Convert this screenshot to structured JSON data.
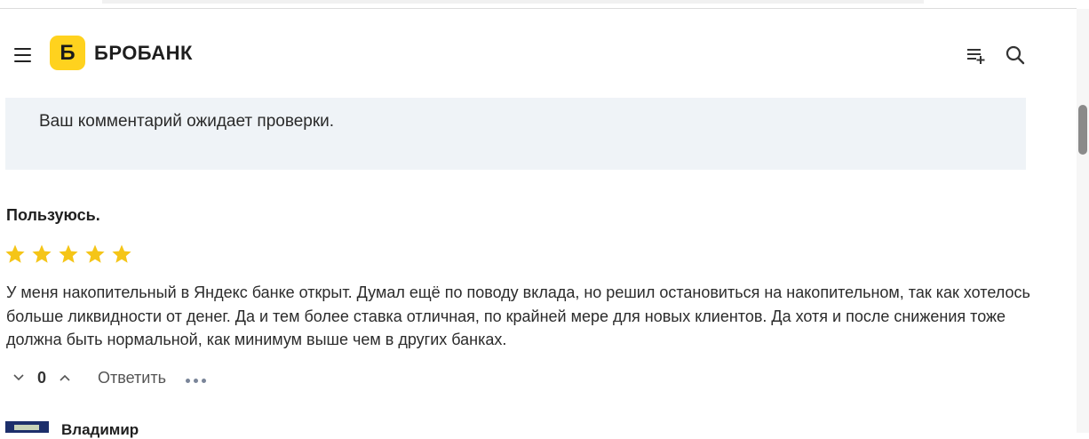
{
  "header": {
    "logo_letter": "Б",
    "logo_name": "БРОБАНК",
    "brand_color": "#ffd21e",
    "icons": [
      "menu-icon",
      "playlist-add-icon",
      "search-icon"
    ]
  },
  "notice": {
    "text": "Ваш комментарий ожидает проверки."
  },
  "review": {
    "title": "Пользуюсь.",
    "rating": 5,
    "rating_max": 5,
    "star_color": "#f5c518",
    "body": "У меня накопительный в Яндекс банке открыт. Думал ещё по поводу вклада, но решил остановиться на накопительном, так как хотелось больше ликвидности от денег. Да и тем более ставка отличная, по крайней мере для новых клиентов. Да хотя и после снижения тоже должна быть нормальной, как минимум выше чем в других банках.",
    "score": "0",
    "reply_label": "Ответить"
  },
  "next_comment": {
    "author": "Владимир"
  }
}
